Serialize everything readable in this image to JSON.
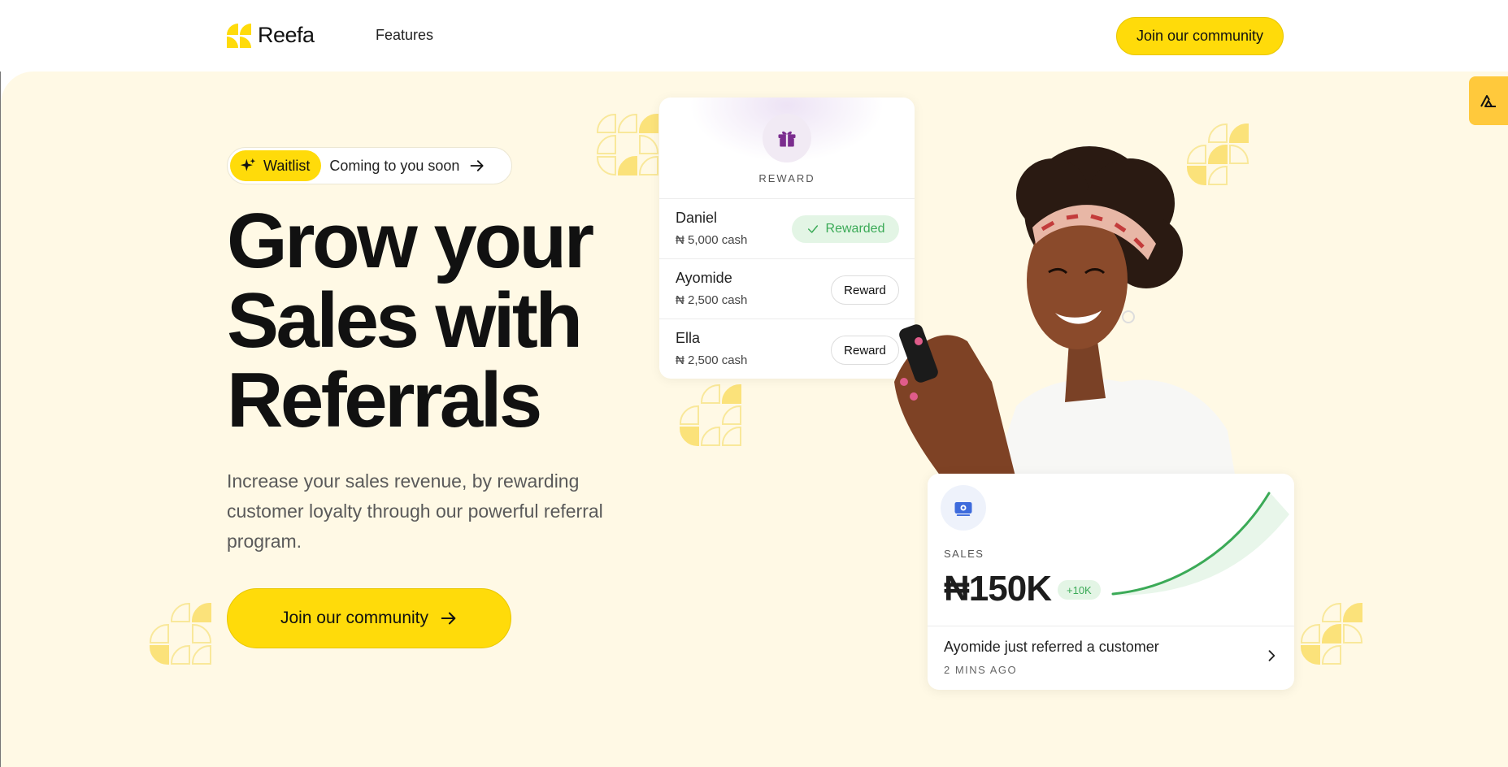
{
  "nav": {
    "brand": "Reefa",
    "links": [
      "Features"
    ],
    "cta_label": "Join our community"
  },
  "hero": {
    "waitlist": {
      "badge": "Waitlist",
      "text": "Coming to you soon"
    },
    "headline_lines": [
      "Grow your",
      "Sales with",
      "Referrals"
    ],
    "subtext": "Increase your sales revenue, by rewarding customer loyalty through our powerful referral program.",
    "cta_label": "Join our community"
  },
  "reward_card": {
    "title": "REWARD",
    "rows": [
      {
        "name": "Daniel",
        "amount": "₦ 5,000 cash",
        "action": "Rewarded",
        "status": "rewarded"
      },
      {
        "name": "Ayomide",
        "amount": "₦ 2,500 cash",
        "action": "Reward",
        "status": "pending"
      },
      {
        "name": "Ella",
        "amount": "₦ 2,500 cash",
        "action": "Reward",
        "status": "pending"
      }
    ]
  },
  "sales_card": {
    "label": "SALES",
    "value": "₦150K",
    "badge": "+10K",
    "activity": "Ayomide just referred a customer",
    "activity_time": "2 MINS AGO"
  },
  "colors": {
    "brand_yellow": "#FFDB0A",
    "hero_bg": "#FFF9E5",
    "success_green": "#3BAA57",
    "gift_purple": "#7B2D8E"
  },
  "icons": [
    "sparkle-icon",
    "arrow-right-icon",
    "gift-icon",
    "check-icon",
    "cash-icon",
    "chevron-right-icon",
    "side-logo-icon"
  ]
}
